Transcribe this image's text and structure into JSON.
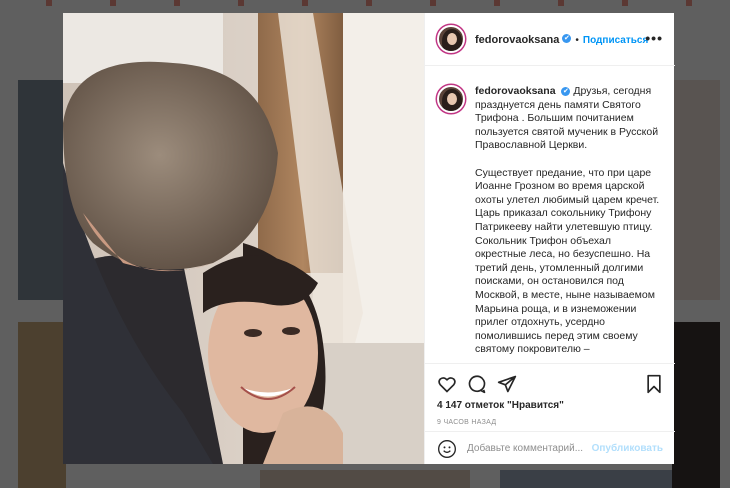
{
  "post": {
    "username": "fedorovaoksana",
    "verified_mark": "✔",
    "dot": "•",
    "follow_label": "Подписаться",
    "more_label": "•••",
    "caption_paragraphs": [
      "Друзья, сегодня празднуется день памяти Святого Трифона . Большим почитанием пользуется святой мученик в Русской Православной Церкви.",
      "Существует предание, что при царе Иоанне Грозном во время царской охоты улетел любимый царем кречет. Царь приказал сокольнику Трифону Патрикееву найти улетевшую птицу. Сокольник Трифон объехал окрестные леса, но безуспешно. На третий день, утомленный долгими поисками, он остановился под Москвой, в месте, ныне называемом Марьина роща, и в изнеможении прилег отдохнуть, усердно помолившись перед этим своему святому покровителю –"
    ],
    "likes": "4 147 отметок \"Нравится\"",
    "time": "9 ЧАСОВ НАЗАД",
    "comment_placeholder": "Добавьте комментарий...",
    "publish_label": "Опубликовать"
  },
  "icons": {
    "like": "heart-icon",
    "comment": "comment-icon",
    "share": "share-icon",
    "save": "bookmark-icon",
    "emoji": "emoji-icon"
  },
  "colors": {
    "accent": "#0095f6",
    "verified": "#3897f0",
    "publish_disabled": "#b2dffc"
  }
}
